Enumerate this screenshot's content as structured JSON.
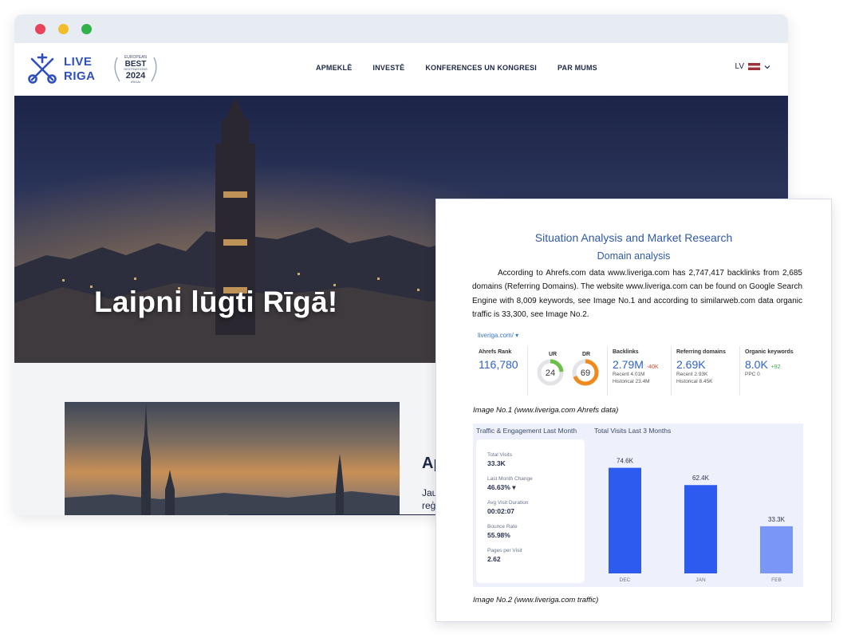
{
  "browser": {
    "dots": [
      "#e8435a",
      "#f2bd2b",
      "#30b14a"
    ]
  },
  "site": {
    "logo_line1": "LIVE",
    "logo_line2": "RIGA",
    "award": {
      "line1": "EUROPEAN",
      "line2": "BEST",
      "line3": "DESTINATIONS",
      "year": "2024",
      "line4": "•RIGA•"
    },
    "nav": [
      "APMEKLĒ",
      "INVESTĒ",
      "KONFERENCES UN KONGRESI",
      "PAR MUMS"
    ],
    "lang": "LV",
    "hero_title": "Laipni lūgti Rīgā!",
    "card_title": "Ap",
    "card_text1": "Jau",
    "card_text2": "reģ"
  },
  "report": {
    "title": "Situation Analysis and Market Research",
    "subtitle": "Domain analysis",
    "paragraph": "According to Ahrefs.com data www.liveriga.com has 2,747,417 backlinks from 2,685 domains (Referring Domains). The website www.liveriga.com can be found on Google Search Engine with 8,009 keywords, see Image No.1 and according to similarweb.com data organic traffic is 33,300, see Image No.2.",
    "ahrefs": {
      "url": "liveriga.com/ ▾",
      "rank_label": "Ahrefs Rank",
      "rank": "116,780",
      "ur_label": "UR",
      "ur": "24",
      "ur_fraction": 0.24,
      "dr_label": "DR",
      "dr": "69",
      "dr_fraction": 0.69,
      "backlinks_label": "Backlinks",
      "backlinks": "2.79M",
      "backlinks_delta": "-40K",
      "backlinks_recent": "Recent 4.01M",
      "backlinks_hist": "Historical 23.4M",
      "refdomains_label": "Referring domains",
      "refdomains": "2.69K",
      "refdomains_recent": "Recent 2.93K",
      "refdomains_hist": "Historical 8.45K",
      "organic_label": "Organic keywords",
      "organic": "8.0K",
      "organic_delta": "+92",
      "ppc": "PPC 0"
    },
    "caption1": "Image No.1 (www.liveriga.com Ahrefs data)",
    "traffic": {
      "head1": "Traffic & Engagement Last Month",
      "head2": "Total Visits Last 3 Months",
      "stats": [
        {
          "label": "Total Visits",
          "value": "33.3K"
        },
        {
          "label": "Last Month Change",
          "value": "46.63% ▾"
        },
        {
          "label": "Avg Visit Duration",
          "value": "00:02:07"
        },
        {
          "label": "Bounce Rate",
          "value": "55.98%"
        },
        {
          "label": "Pages per Visit",
          "value": "2.62"
        }
      ]
    },
    "caption2": "Image No.2 (www.liveriga.com traffic)"
  },
  "chart_data": {
    "type": "bar",
    "title": "Total Visits Last 3 Months",
    "categories": [
      "DEC",
      "JAN",
      "FEB"
    ],
    "values": [
      74.6,
      62.4,
      33.3
    ],
    "labels": [
      "74.6K",
      "62.4K",
      "33.3K"
    ],
    "colors": [
      "#2d5bf0",
      "#2d5bf0",
      "#7a96f6"
    ],
    "ylim": [
      0,
      80
    ]
  }
}
